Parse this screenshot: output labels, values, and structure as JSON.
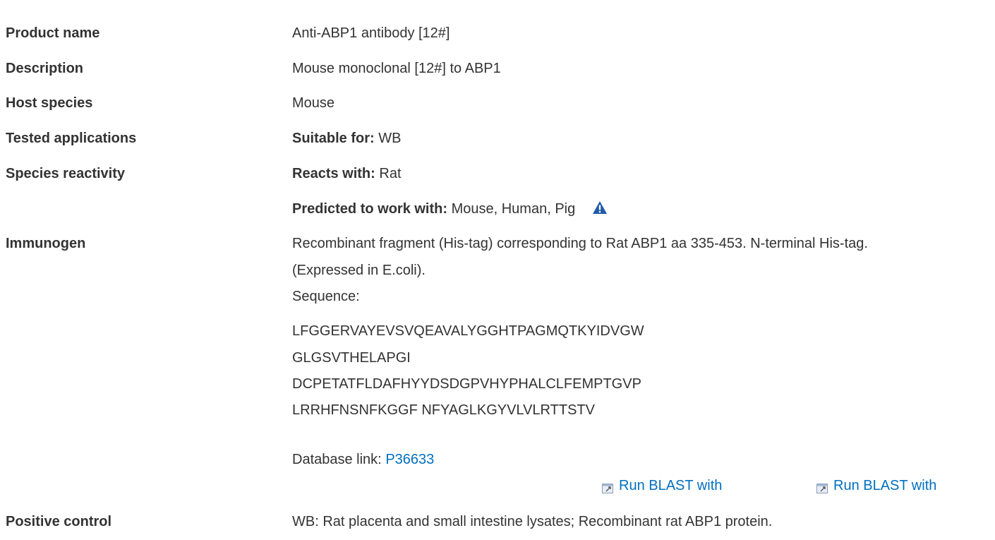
{
  "rows": {
    "product_name": {
      "label": "Product name",
      "value": "Anti-ABP1 antibody [12#]"
    },
    "description": {
      "label": "Description",
      "value": "Mouse monoclonal [12#] to ABP1"
    },
    "host_species": {
      "label": "Host species",
      "value": "Mouse"
    },
    "tested_applications": {
      "label": "Tested applications",
      "prefix": "Suitable for:",
      "value": "WB"
    },
    "species_reactivity": {
      "label": "Species reactivity",
      "reacts_prefix": "Reacts with:",
      "reacts_value": "Rat",
      "predicted_prefix": "Predicted to work with:",
      "predicted_value": "Mouse, Human, Pig"
    },
    "immunogen": {
      "label": "Immunogen",
      "line1": "Recombinant fragment (His-tag) corresponding to Rat ABP1 aa 335-453. N-terminal His-tag.",
      "line2": "(Expressed in E.coli).",
      "sequence_label": "Sequence:",
      "sequence_lines": [
        "LFGGERVAYEVSVQEAVALYGGHTPAGMQTKYIDVGW",
        "GLGSVTHELAPGI",
        "DCPETATFLDAFHYYDSDGPVHYPHALCLFEMPTGVP",
        "LRRHFNSNFKGGF NFYAGLKGYVLVLRTTSTV"
      ],
      "database_label": "Database link:",
      "database_link": "P36633",
      "blast_links": [
        "Run BLAST with",
        "Run BLAST with"
      ]
    },
    "positive_control": {
      "label": "Positive control",
      "value": "WB: Rat placenta and small intestine lysates; Recombinant rat ABP1 protein."
    }
  },
  "colors": {
    "text": "#333333",
    "link": "#0070c0",
    "warning": "#1f5aa6"
  },
  "icons": {
    "warning": "warning-triangle-icon",
    "external": "external-link-icon"
  }
}
